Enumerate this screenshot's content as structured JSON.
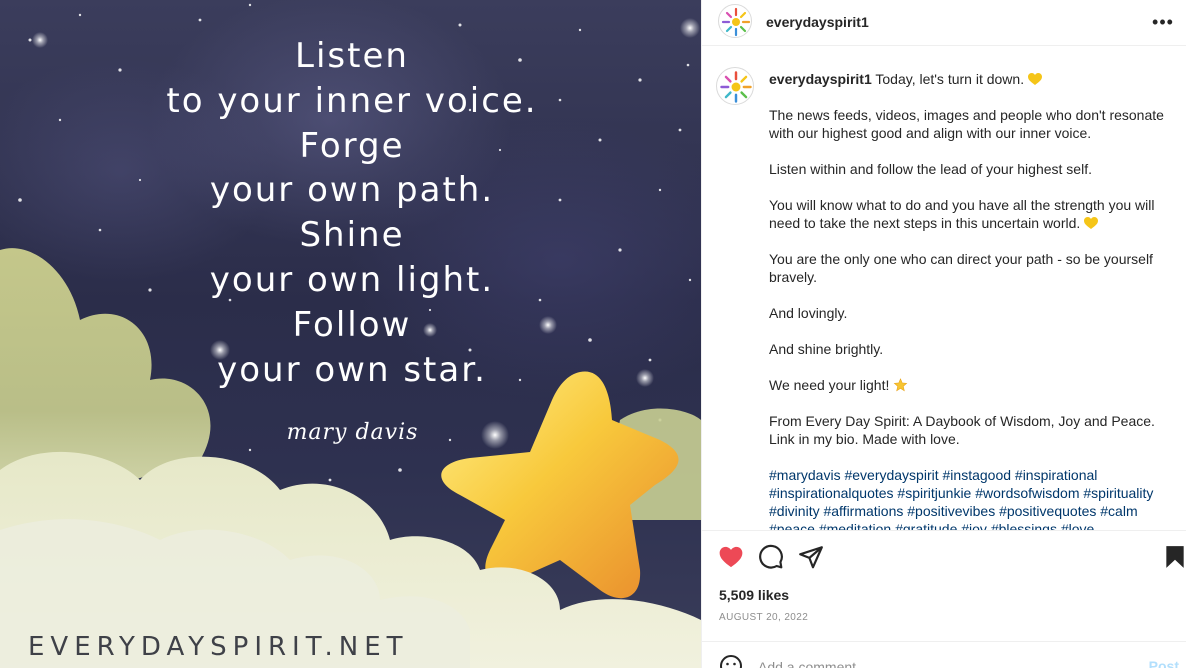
{
  "image": {
    "quote_lines": [
      "Listen",
      "to your inner voice.",
      "Forge",
      "your own path.",
      "Shine",
      "your own light.",
      "Follow",
      "your own star."
    ],
    "signature": "mary davis",
    "site_mark": "EVERYDAYSPIRIT.NET"
  },
  "header": {
    "username": "everydayspirit1",
    "avatar_icon": "sun-logo-icon",
    "more_label": "•••"
  },
  "caption": {
    "username": "everydayspirit1",
    "first_line": " Today, let's turn it down.",
    "paragraphs": [
      "The news feeds, videos, images and people who don't resonate with our highest good and align with our inner voice.",
      "Listen within and follow the lead of your highest self.",
      "You will know what to do and you have all the strength you will need to take the next steps in this uncertain world.",
      "You are the only one who can direct your path - so be yourself bravely.",
      "And lovingly.",
      "And shine brightly.",
      "We need your light!",
      "From Every Day Spirit: A Daybook of Wisdom, Joy and Peace. Link in my bio. Made with love."
    ],
    "hashtags": "#marydavis #everydayspirit #instagood #inspirational #inspirationalquotes #spiritjunkie #wordsofwisdom #spirituality #divinity #affirmations #positivevibes #positivequotes #calm #peace #meditation #gratitude #joy #blessings #love"
  },
  "actions": {
    "like_icon": "heart-filled-icon",
    "comment_icon": "comment-icon",
    "share_icon": "paper-plane-icon",
    "save_icon": "bookmark-icon",
    "likes_text": "5,509 likes",
    "date_text": "AUGUST 20, 2022"
  },
  "comment_bar": {
    "placeholder": "Add a comment…",
    "post_label": "Post"
  },
  "colors": {
    "like_red": "#ed4956",
    "hashtag_blue": "#00376b",
    "heart_yellow": "#f5c518"
  }
}
